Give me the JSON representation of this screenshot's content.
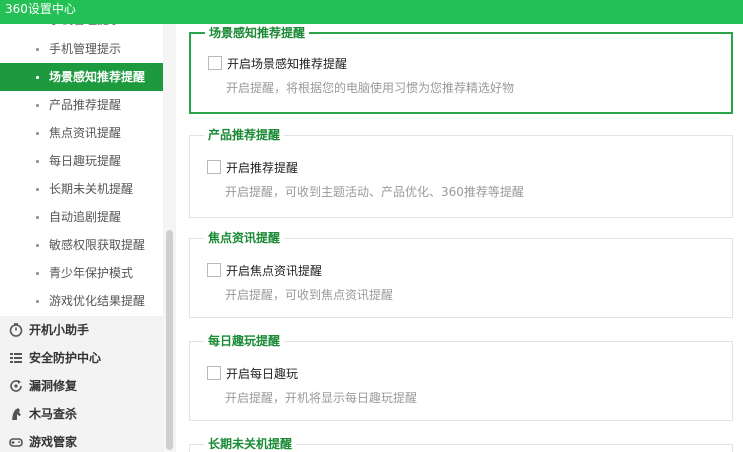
{
  "window": {
    "title": "360设置中心"
  },
  "sidebar": {
    "clipped_item": "手机管理提示",
    "items": [
      {
        "label": "手机管理提示",
        "active": false
      },
      {
        "label": "场景感知推荐提醒",
        "active": true
      },
      {
        "label": "产品推荐提醒",
        "active": false
      },
      {
        "label": "焦点资讯提醒",
        "active": false
      },
      {
        "label": "每日趣玩提醒",
        "active": false
      },
      {
        "label": "长期未关机提醒",
        "active": false
      },
      {
        "label": "自动追剧提醒",
        "active": false
      },
      {
        "label": "敏感权限获取提醒",
        "active": false
      },
      {
        "label": "青少年保护模式",
        "active": false
      },
      {
        "label": "游戏优化结果提醒",
        "active": false
      }
    ],
    "groups": [
      {
        "label": "开机小助手",
        "icon": "power-timer-icon"
      },
      {
        "label": "安全防护中心",
        "icon": "shield-list-icon"
      },
      {
        "label": "漏洞修复",
        "icon": "patch-refresh-icon"
      },
      {
        "label": "木马查杀",
        "icon": "horse-icon"
      },
      {
        "label": "游戏管家",
        "icon": "gamepad-icon"
      }
    ]
  },
  "sections": [
    {
      "title": "场景感知推荐提醒",
      "checkbox": "开启场景感知推荐提醒",
      "desc": "开启提醒，将根据您的电脑使用习惯为您推荐精选好物",
      "checked": false
    },
    {
      "title": "产品推荐提醒",
      "checkbox": "开启推荐提醒",
      "desc": "开启提醒，可收到主题活动、产品优化、360推荐等提醒",
      "checked": false
    },
    {
      "title": "焦点资讯提醒",
      "checkbox": "开启焦点资讯提醒",
      "desc": "开启提醒，可收到焦点资讯提醒",
      "checked": false
    },
    {
      "title": "每日趣玩提醒",
      "checkbox": "开启每日趣玩",
      "desc": "开启提醒，开机将显示每日趣玩提醒",
      "checked": false
    },
    {
      "title": "长期未关机提醒"
    }
  ],
  "colors": {
    "titlebar": "#23c155",
    "active": "#1d9a3d",
    "section_title": "#1a8a35"
  }
}
